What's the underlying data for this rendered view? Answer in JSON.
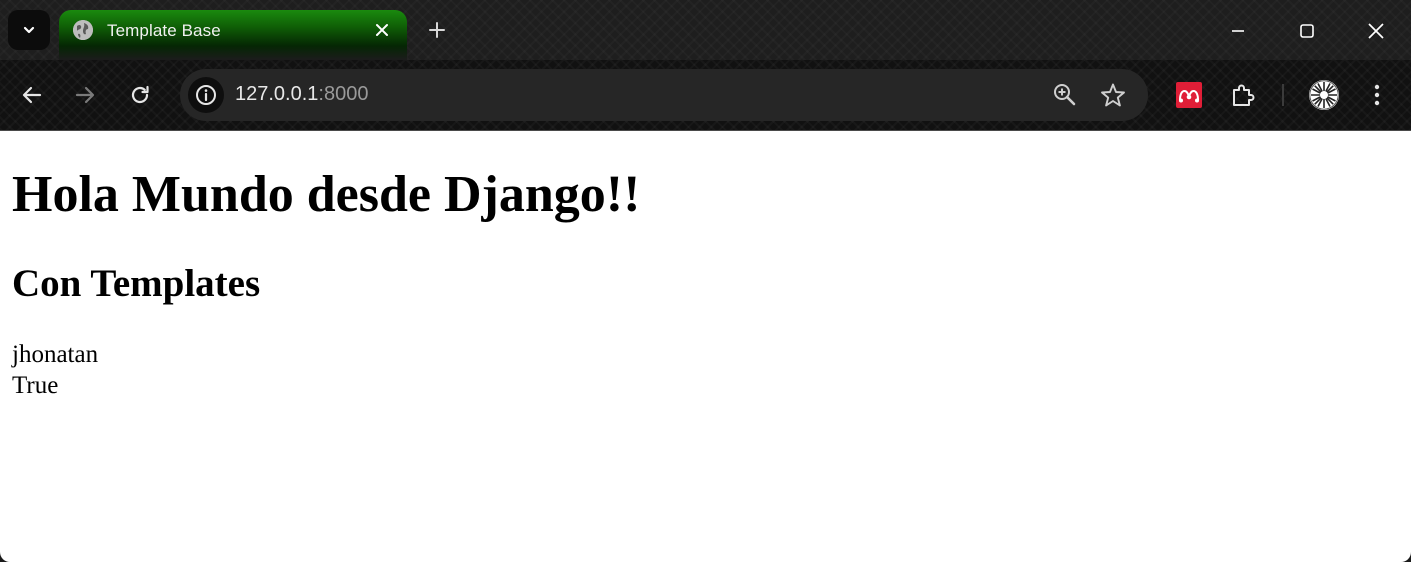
{
  "browser": {
    "tab": {
      "title": "Template Base",
      "favicon": "globe-icon"
    },
    "address_bar": {
      "host": "127.0.0.1",
      "port": ":8000"
    },
    "icons": {
      "tab_search": "chevron-down-icon",
      "tab_close": "close-icon",
      "new_tab": "plus-icon",
      "minimize": "minimize-icon",
      "maximize": "maximize-icon",
      "close_window": "close-icon",
      "back": "arrow-left-icon",
      "forward": "arrow-right-icon",
      "reload": "reload-icon",
      "site_info": "info-icon",
      "zoom": "zoom-in-icon",
      "bookmark": "star-icon",
      "extension_mendeley": "mendeley-icon",
      "extensions": "puzzle-icon",
      "profile": "avatar",
      "menu": "kebab-menu-icon"
    },
    "colors": {
      "tab_accent": "#1a8a0e",
      "extension_red": "#e01e37"
    }
  },
  "page": {
    "heading": "Hola Mundo desde Django!!",
    "subheading": "Con Templates",
    "lines": [
      "jhonatan",
      "True"
    ]
  }
}
